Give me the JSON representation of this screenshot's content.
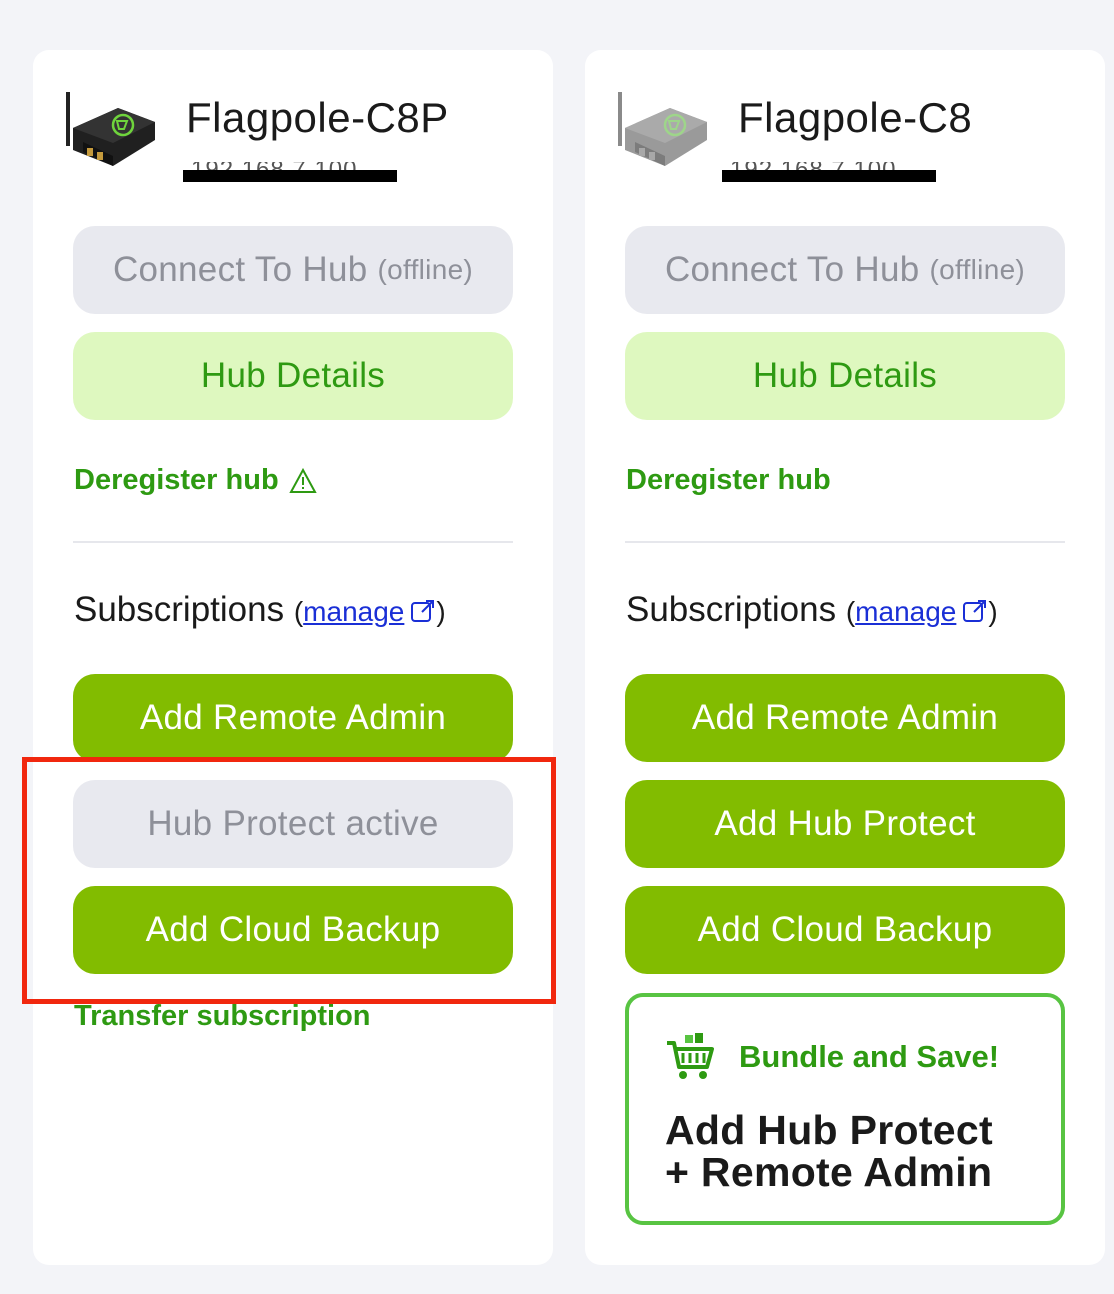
{
  "colors": {
    "page_background": "#f3f4f8",
    "card_background": "#ffffff",
    "primary_green": "#82bc00",
    "link_green": "#2e9a12",
    "light_green_button": "#def8bf",
    "disabled_gray": "#e8e9ef",
    "highlight_red": "#f1270e",
    "manage_link_blue": "#1a2fd6"
  },
  "hubs": [
    {
      "name": "Flagpole-C8P",
      "ip": "192.168.7.100",
      "ip_redacted": true,
      "icon": "hub-device-icon",
      "connect_label": "Connect To Hub",
      "connect_status": "(offline)",
      "details_label": "Hub Details",
      "deregister_label": "Deregister hub",
      "deregister_warning_icon": "warning-triangle-icon",
      "subscriptions_label": "Subscriptions",
      "paren_open": "(",
      "manage_label": "manage",
      "paren_close": ")",
      "buttons": [
        {
          "label": "Add Remote Admin",
          "state": "enabled"
        },
        {
          "label": "Hub Protect active",
          "state": "disabled"
        },
        {
          "label": "Add Cloud Backup",
          "state": "enabled"
        }
      ],
      "transfer_label": "Transfer subscription",
      "highlighted": true
    },
    {
      "name": "Flagpole-C8",
      "ip": "192.168.7.100",
      "ip_redacted": true,
      "icon": "hub-device-icon",
      "connect_label": "Connect To Hub",
      "connect_status": "(offline)",
      "details_label": "Hub Details",
      "deregister_label": "Deregister hub",
      "subscriptions_label": "Subscriptions",
      "paren_open": "(",
      "manage_label": "manage",
      "paren_close": ")",
      "buttons": [
        {
          "label": "Add Remote Admin",
          "state": "enabled"
        },
        {
          "label": "Add Hub Protect",
          "state": "enabled"
        },
        {
          "label": "Add Cloud Backup",
          "state": "enabled"
        }
      ],
      "bundle": {
        "icon": "shopping-cart-icon",
        "title": "Bundle and Save!",
        "line1": "Add Hub Protect",
        "line2": "+ Remote Admin"
      }
    }
  ]
}
